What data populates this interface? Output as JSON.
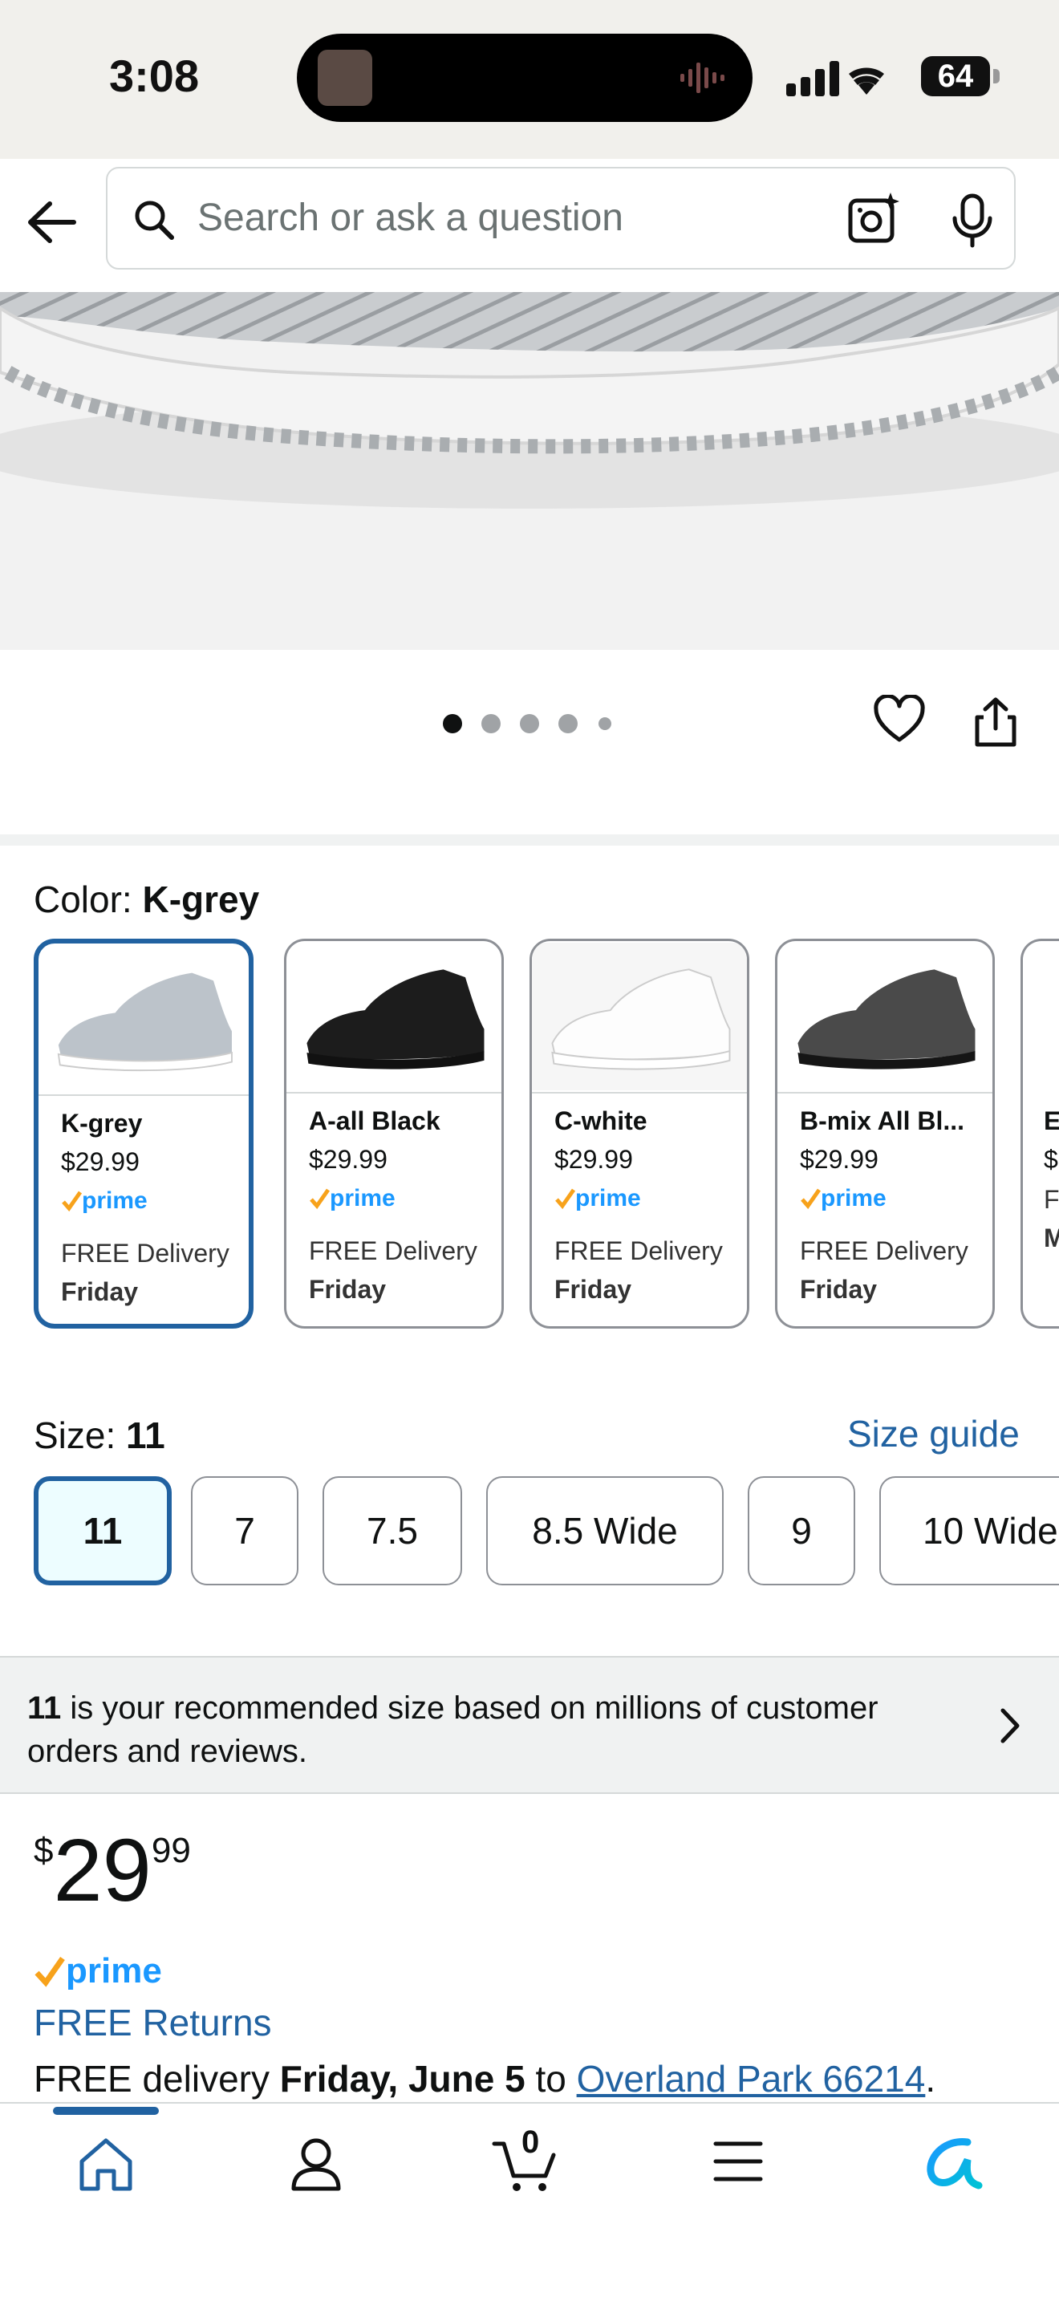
{
  "status": {
    "time": "3:08",
    "battery": "64"
  },
  "search": {
    "placeholder": "Search or ask a question"
  },
  "color": {
    "label": "Color: ",
    "selected": "K-grey"
  },
  "swatches": [
    {
      "name": "K-grey",
      "price": "$29.99",
      "delivery": "FREE Delivery",
      "day": "Friday",
      "shoe_color": "#bcc3ca",
      "sole": "#ffffff"
    },
    {
      "name": "A-all Black",
      "price": "$29.99",
      "delivery": "FREE Delivery",
      "day": "Friday",
      "shoe_color": "#1c1c1c",
      "sole": "#111111"
    },
    {
      "name": "C-white",
      "price": "$29.99",
      "delivery": "FREE Delivery",
      "day": "Friday",
      "shoe_color": "#f3f3f3",
      "sole": "#ffffff"
    },
    {
      "name": "B-mix All Bl...",
      "price": "$29.99",
      "delivery": "FREE Delivery",
      "day": "Friday",
      "shoe_color": "#4a4a4a",
      "sole": "#151515"
    },
    {
      "name": "E",
      "price": "$",
      "delivery": "FI",
      "day": "M",
      "shoe_color": "#777777",
      "sole": "#333333"
    }
  ],
  "prime_label": "prime",
  "size": {
    "label": "Size: ",
    "selected": "11",
    "guide": "Size guide"
  },
  "sizes": [
    "11",
    "7",
    "7.5",
    "8.5 Wide",
    "9",
    "10 Wide"
  ],
  "recommendation": {
    "size": "11",
    "text": " is your recommended size based on millions of customer orders and reviews."
  },
  "price": {
    "currency": "$",
    "whole": "29",
    "fraction": "99"
  },
  "returns": "FREE Returns",
  "delivery": {
    "prefix": "FREE delivery ",
    "date": "Friday, June 5",
    "to": " to ",
    "location": "Overland Park 66214",
    "suffix": "."
  },
  "nav": {
    "cart_count": "0"
  },
  "colors": {
    "accent": "#2162a1",
    "prime_blue": "#1a98ff",
    "prime_orange": "#f7a21b"
  }
}
